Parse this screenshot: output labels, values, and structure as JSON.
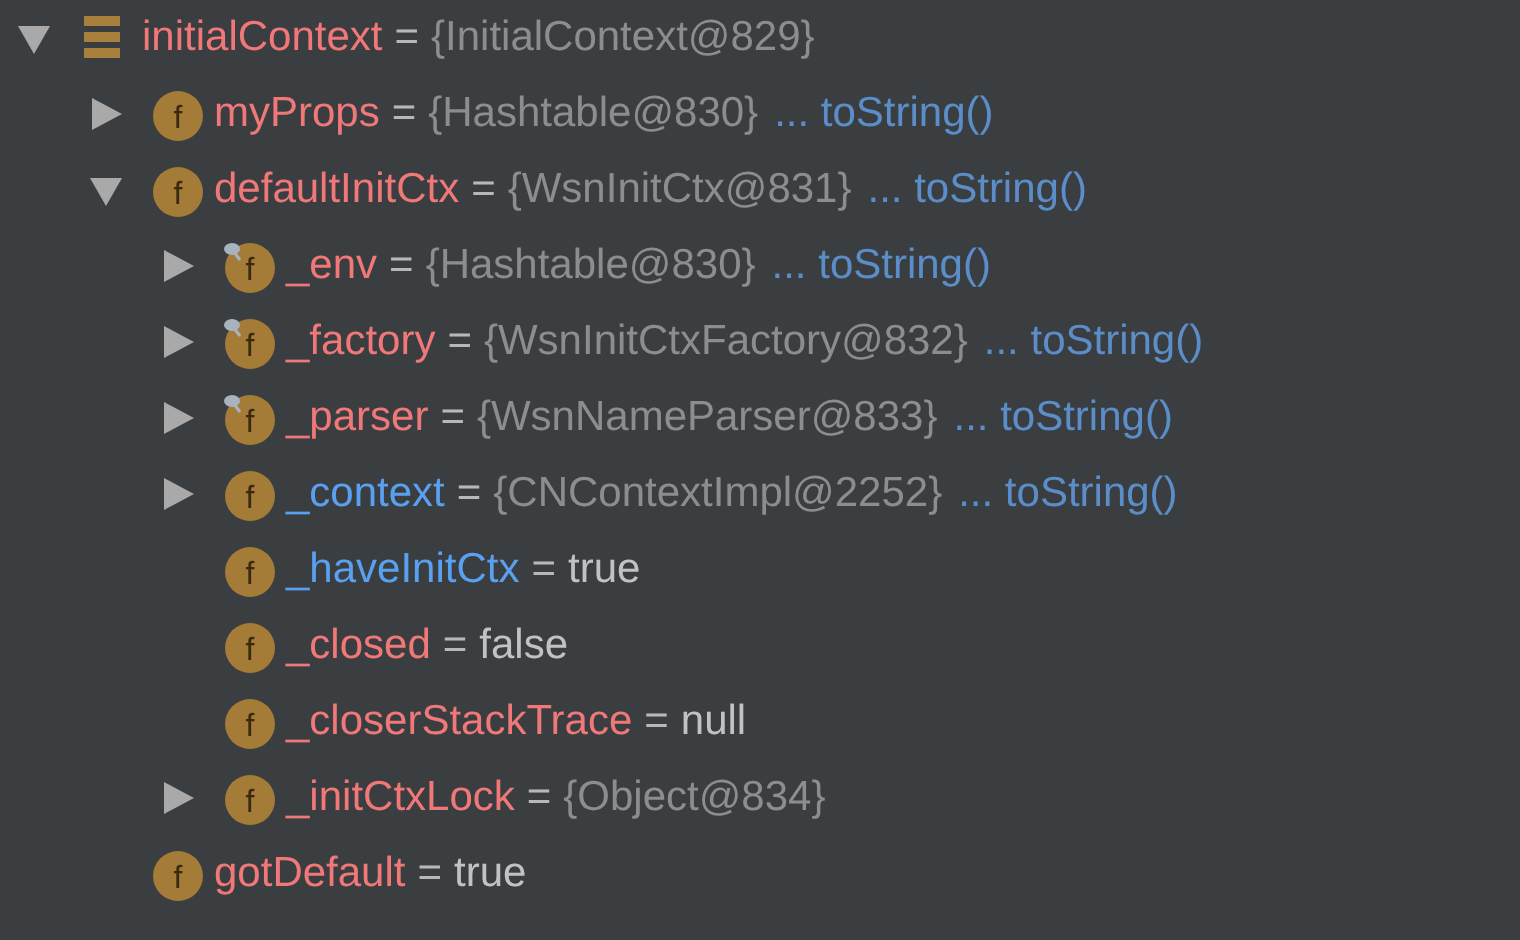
{
  "variables": [
    {
      "kind": "local",
      "name": "initialContext",
      "color": "#f07878",
      "equals": "=",
      "value": "{InitialContext@829}",
      "primitive": false,
      "expandable": true,
      "expanded": true,
      "children": [
        {
          "kind": "field",
          "icon_letter": "f",
          "name": "myProps",
          "color": "#f07878",
          "equals": "=",
          "value": "{Hashtable@830}",
          "primitive": false,
          "action": "... toString()",
          "expandable": true,
          "expanded": false
        },
        {
          "kind": "field",
          "icon_letter": "f",
          "name": "defaultInitCtx",
          "color": "#f07878",
          "equals": "=",
          "value": "{WsnInitCtx@831}",
          "primitive": false,
          "action": "... toString()",
          "expandable": true,
          "expanded": true,
          "children": [
            {
              "kind": "pinned_field",
              "icon_letter": "f",
              "name": "_env",
              "color": "#f07878",
              "equals": "=",
              "value": "{Hashtable@830}",
              "primitive": false,
              "action": "... toString()",
              "expandable": true,
              "expanded": false
            },
            {
              "kind": "pinned_field",
              "icon_letter": "f",
              "name": "_factory",
              "color": "#f07878",
              "equals": "=",
              "value": "{WsnInitCtxFactory@832}",
              "primitive": false,
              "action": "... toString()",
              "expandable": true,
              "expanded": false
            },
            {
              "kind": "pinned_field",
              "icon_letter": "f",
              "name": "_parser",
              "color": "#f07878",
              "equals": "=",
              "value": "{WsnNameParser@833}",
              "primitive": false,
              "action": "... toString()",
              "expandable": true,
              "expanded": false
            },
            {
              "kind": "field",
              "icon_letter": "f",
              "name": "_context",
              "color": "#5aa0f0",
              "equals": "=",
              "value": "{CNContextImpl@2252}",
              "primitive": false,
              "action": "... toString()",
              "expandable": true,
              "expanded": false
            },
            {
              "kind": "field",
              "icon_letter": "f",
              "name": "_haveInitCtx",
              "color": "#5aa0f0",
              "equals": "=",
              "value": "true",
              "primitive": true,
              "expandable": false
            },
            {
              "kind": "field",
              "icon_letter": "f",
              "name": "_closed",
              "color": "#f07878",
              "equals": "=",
              "value": "false",
              "primitive": true,
              "expandable": false
            },
            {
              "kind": "field",
              "icon_letter": "f",
              "name": "_closerStackTrace",
              "color": "#f07878",
              "equals": "=",
              "value": "null",
              "primitive": true,
              "expandable": false
            },
            {
              "kind": "field",
              "icon_letter": "f",
              "name": "_initCtxLock",
              "color": "#f07878",
              "equals": "=",
              "value": "{Object@834}",
              "primitive": false,
              "expandable": true,
              "expanded": false
            }
          ]
        },
        {
          "kind": "field",
          "icon_letter": "f",
          "name": "gotDefault",
          "color": "#f07878",
          "equals": "=",
          "value": "true",
          "primitive": true,
          "expandable": false
        }
      ]
    }
  ]
}
